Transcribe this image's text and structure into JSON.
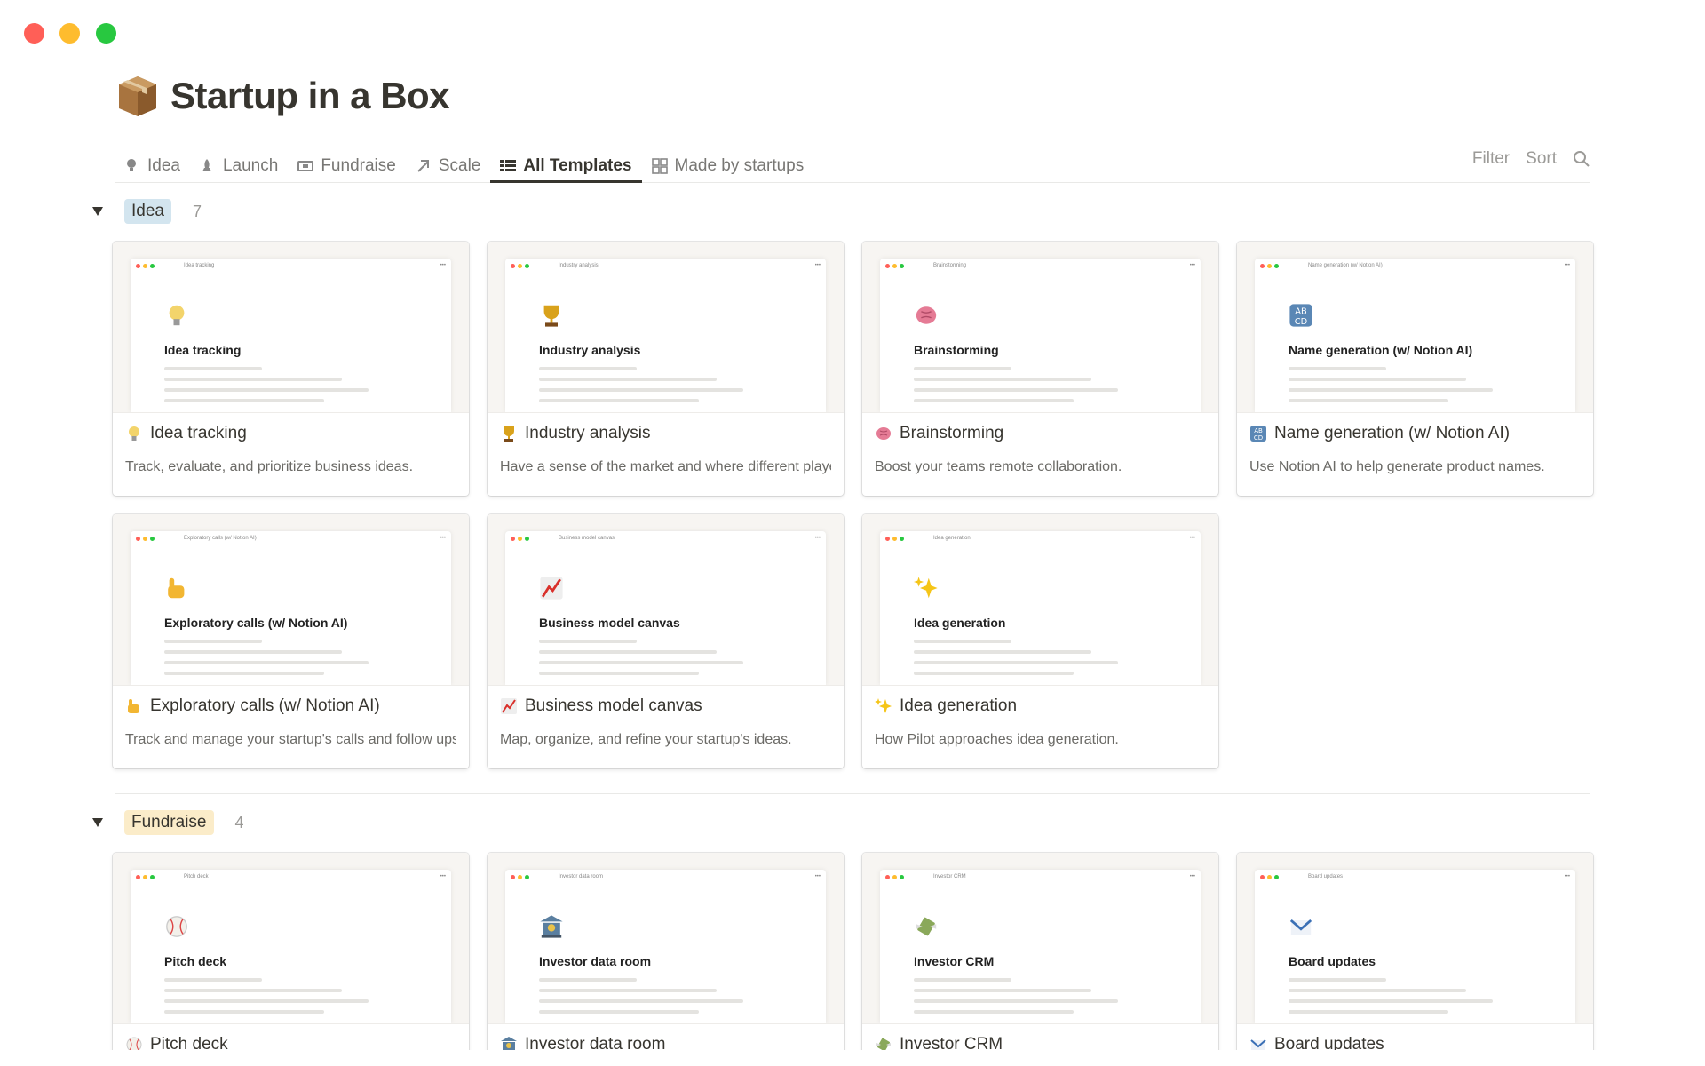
{
  "window": {
    "traffic_lights": [
      "#ff5f57",
      "#febc2e",
      "#28c840"
    ]
  },
  "page": {
    "title": "Startup in a Box",
    "icon": "package-icon"
  },
  "tabs": [
    {
      "label": "Idea",
      "icon": "lightbulb-icon",
      "active": false
    },
    {
      "label": "Launch",
      "icon": "rocket-icon",
      "active": false
    },
    {
      "label": "Fundraise",
      "icon": "money-icon",
      "active": false
    },
    {
      "label": "Scale",
      "icon": "arrow-up-right-icon",
      "active": false
    },
    {
      "label": "All Templates",
      "icon": "table-icon",
      "active": true
    },
    {
      "label": "Made by startups",
      "icon": "gallery-icon",
      "active": false
    }
  ],
  "toolbar": {
    "filter": "Filter",
    "sort": "Sort",
    "search_icon": "search-icon"
  },
  "groups": [
    {
      "label": "Idea",
      "count": "7",
      "color": "#d3e5ef",
      "cards": [
        {
          "title": "Idea tracking",
          "desc": "Track, evaluate, and prioritize business ideas.",
          "icon": "lightbulb-icon",
          "color": "#f3d46b",
          "preview_title": "Idea tracking",
          "preview_bar": "Idea tracking"
        },
        {
          "title": "Industry analysis",
          "desc": "Have a sense of the market and where different players stand.",
          "icon": "trophy-icon",
          "color": "#d9a21b",
          "preview_title": "Industry analysis",
          "preview_bar": "Industry analysis"
        },
        {
          "title": "Brainstorming",
          "desc": "Boost your teams remote collaboration.",
          "icon": "brain-icon",
          "color": "#e57b95",
          "preview_title": "Brainstorming",
          "preview_bar": "Brainstorming"
        },
        {
          "title": "Name generation (w/ Notion AI)",
          "desc": "Use Notion AI to help generate product names.",
          "icon": "abcd-icon",
          "color": "#5a87b5",
          "preview_title": "Name generation (w/ Notion AI)",
          "preview_bar": "Name generation (w/ Notion AI)"
        },
        {
          "title": "Exploratory calls (w/ Notion AI)",
          "desc": "Track and manage your startup's calls and follow ups.",
          "icon": "call-me-hand-icon",
          "color": "#f2b632",
          "preview_title": "Exploratory calls (w/ Notion AI)",
          "preview_bar": "Exploratory calls (w/ Notion AI)"
        },
        {
          "title": "Business model canvas",
          "desc": "Map, organize, and refine your startup's ideas.",
          "icon": "chart-increasing-icon",
          "color": "#d9302b",
          "preview_title": "Business model canvas",
          "preview_bar": "Business model canvas"
        },
        {
          "title": "Idea generation",
          "desc": "How Pilot approaches idea generation.",
          "icon": "sparkles-icon",
          "color": "#f5c518",
          "preview_title": "Idea generation",
          "preview_bar": "Idea generation"
        }
      ]
    },
    {
      "label": "Fundraise",
      "count": "4",
      "color": "#fbecc9",
      "cards": [
        {
          "title": "Pitch deck",
          "desc": "",
          "icon": "baseball-icon",
          "color": "#d44",
          "preview_title": "Pitch deck",
          "preview_bar": "Pitch deck"
        },
        {
          "title": "Investor data room",
          "desc": "",
          "icon": "bank-icon",
          "color": "#5a7fa0",
          "preview_title": "Investor data room",
          "preview_bar": "Investor data room"
        },
        {
          "title": "Investor CRM",
          "desc": "",
          "icon": "money-wings-icon",
          "color": "#8aa85a",
          "preview_title": "Investor CRM",
          "preview_bar": "Investor CRM"
        },
        {
          "title": "Board updates",
          "desc": "",
          "icon": "envelope-icon",
          "color": "#3a6fb5",
          "preview_title": "Board updates",
          "preview_bar": "Board updates"
        }
      ]
    }
  ]
}
